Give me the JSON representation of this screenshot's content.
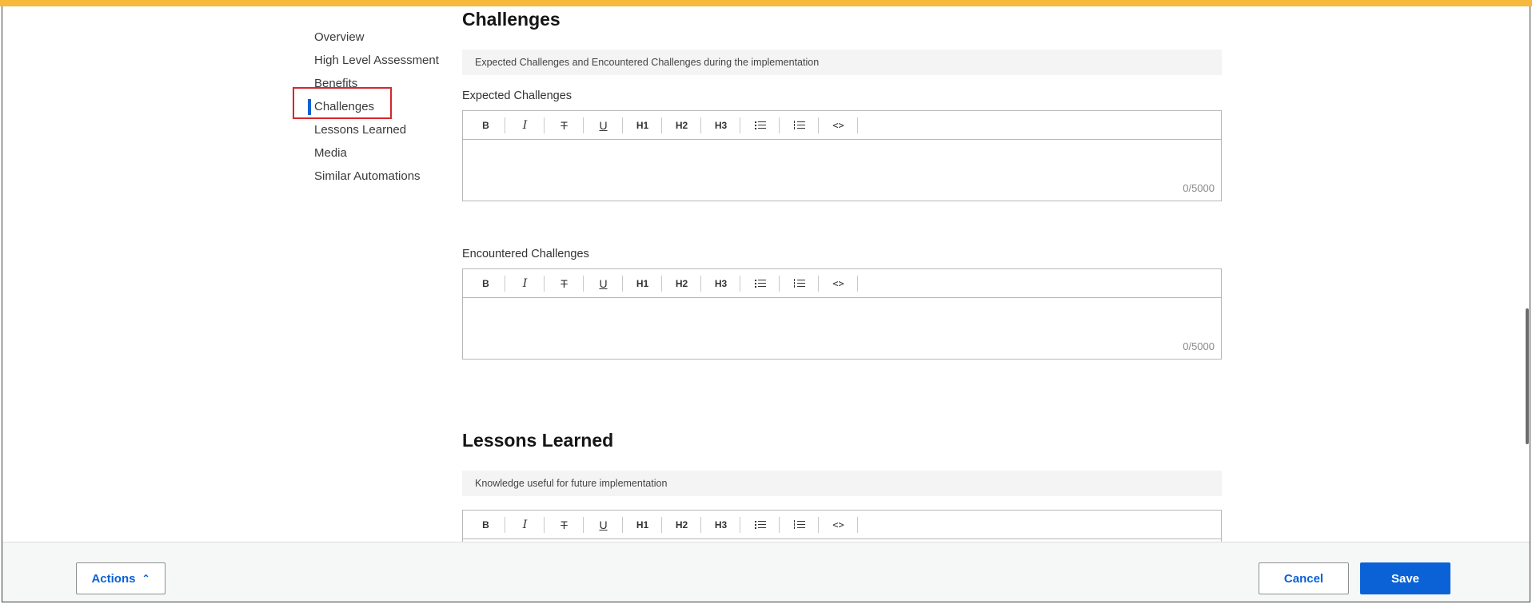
{
  "nav": {
    "items": [
      {
        "label": "Overview"
      },
      {
        "label": "High Level Assessment"
      },
      {
        "label": "Benefits"
      },
      {
        "label": "Challenges",
        "active": true
      },
      {
        "label": "Lessons Learned"
      },
      {
        "label": "Media"
      },
      {
        "label": "Similar Automations"
      }
    ]
  },
  "toolbar": {
    "bold": "B",
    "italic": "I",
    "strike": "T",
    "underline": "U",
    "h1": "H1",
    "h2": "H2",
    "h3": "H3",
    "bullet_list_icon": "bulleted-list-icon",
    "numbered_list_icon": "numbered-list-icon",
    "code": "<>"
  },
  "challenges": {
    "title": "Challenges",
    "description": "Expected Challenges and Encountered Challenges during the implementation",
    "expected": {
      "label": "Expected Challenges",
      "counter": "0/5000"
    },
    "encountered": {
      "label": "Encountered Challenges",
      "counter": "0/5000"
    }
  },
  "lessons": {
    "title": "Lessons Learned",
    "description": "Knowledge useful for future implementation"
  },
  "footer": {
    "actions_label": "Actions",
    "cancel_label": "Cancel",
    "save_label": "Save"
  },
  "colors": {
    "accent": "#0b62d6",
    "highlight_box": "#d8262b",
    "top_strip": "#f6b93b"
  }
}
